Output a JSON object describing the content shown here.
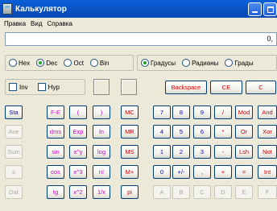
{
  "window": {
    "title": "Калькулятор",
    "icon": "calculator-icon"
  },
  "menu": [
    "Правка",
    "Вид",
    "Справка"
  ],
  "display": {
    "value": "0,"
  },
  "base_radios": [
    {
      "label": "Hex",
      "selected": false
    },
    {
      "label": "Dec",
      "selected": true
    },
    {
      "label": "Oct",
      "selected": false
    },
    {
      "label": "Bin",
      "selected": false
    }
  ],
  "angle_radios": [
    {
      "label": "Градусы",
      "selected": true
    },
    {
      "label": "Радианы",
      "selected": false
    },
    {
      "label": "Грады",
      "selected": false
    }
  ],
  "checks": {
    "inv": "Inv",
    "hyp": "Hyp"
  },
  "top_buttons": {
    "backspace": "Backspace",
    "ce": "CE",
    "c": "C"
  },
  "sci_col1": [
    "Sta",
    "Ave",
    "Sum",
    "s",
    "Dat"
  ],
  "sci_col2": [
    "F-E",
    "dms",
    "sin",
    "cos",
    "tg"
  ],
  "sci_col3": [
    "(",
    "Exp",
    "x^y",
    "x^3",
    "x^2"
  ],
  "sci_col4": [
    ")",
    "ln",
    "log",
    "n!",
    "1/x"
  ],
  "mem_col": [
    "MC",
    "MR",
    "MS",
    "M+",
    "pi"
  ],
  "pad_rows": [
    [
      "7",
      "8",
      "9",
      "/",
      "Mod",
      "And"
    ],
    [
      "4",
      "5",
      "6",
      "*",
      "Or",
      "Xor"
    ],
    [
      "1",
      "2",
      "3",
      "-",
      "Lsh",
      "Not"
    ],
    [
      "0",
      "+/-",
      ",",
      "+",
      "=",
      "Int"
    ],
    [
      "A",
      "B",
      "C",
      "D",
      "E",
      "F"
    ]
  ],
  "colors": {
    "title_bar": "#0a55c8",
    "face": "#ece9d8",
    "digit_blue": "#0000cc",
    "func_purple": "#cc00cc",
    "op_red": "#d00000"
  }
}
